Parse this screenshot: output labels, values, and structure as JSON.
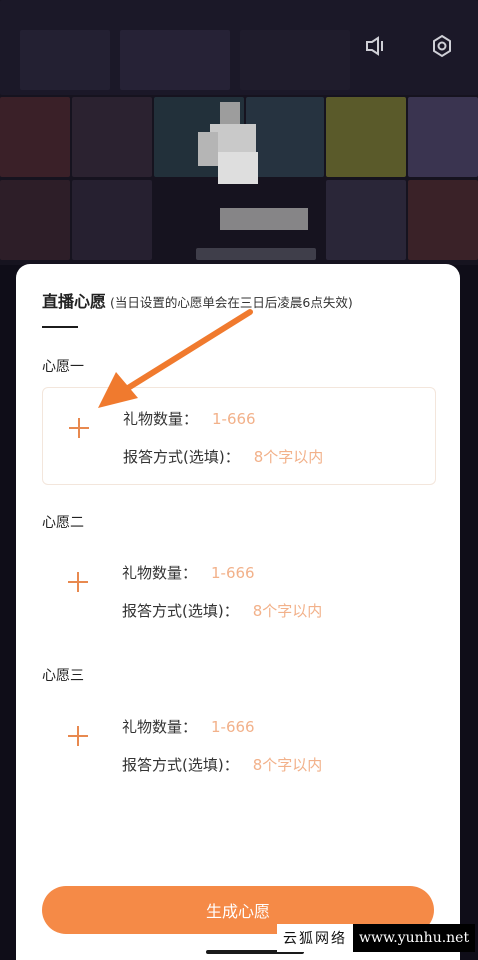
{
  "header": {
    "title": "直播心愿",
    "hint": "(当日设置的心愿单会在三日后凌晨6点失效)"
  },
  "wishes": [
    {
      "label": "心愿一",
      "gift_label": "礼物数量：",
      "gift_placeholder": "1-666",
      "reply_label": "报答方式(选填)：",
      "reply_placeholder": "8个字以内"
    },
    {
      "label": "心愿二",
      "gift_label": "礼物数量：",
      "gift_placeholder": "1-666",
      "reply_label": "报答方式(选填)：",
      "reply_placeholder": "8个字以内"
    },
    {
      "label": "心愿三",
      "gift_label": "礼物数量：",
      "gift_placeholder": "1-666",
      "reply_label": "报答方式(选填)：",
      "reply_placeholder": "8个字以内"
    }
  ],
  "generate_label": "生成心愿",
  "watermark": {
    "left": "云狐网络",
    "right": "www.yunhu.net"
  },
  "icons": {
    "top_left": "speaker-icon",
    "top_right": "settings-gear-icon",
    "add": "plus-icon"
  },
  "colors": {
    "accent": "#f58a47",
    "placeholder": "#f2b18a",
    "plus": "#e8894f"
  }
}
